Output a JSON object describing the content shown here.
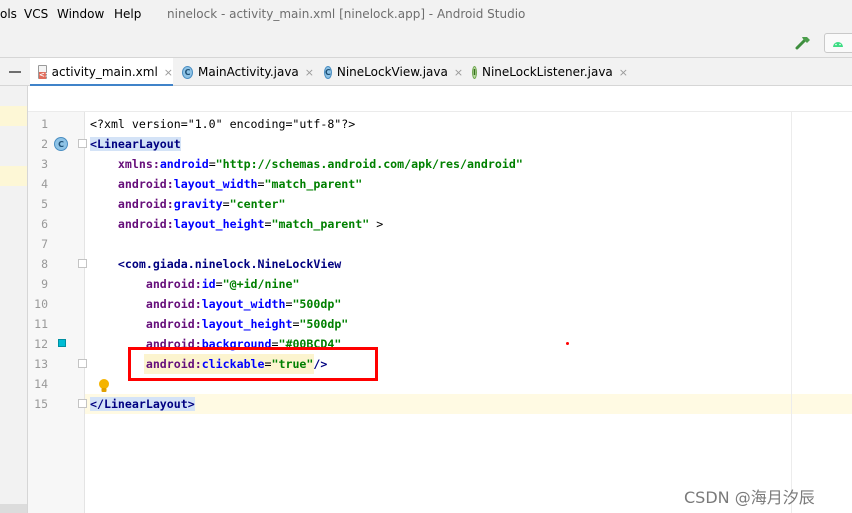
{
  "menu": {
    "items": [
      "ols",
      "VCS",
      "Window",
      "Help"
    ]
  },
  "window_title": "ninelock - activity_main.xml [ninelock.app] - Android Studio",
  "tabs": [
    {
      "label": "activity_main.xml",
      "icon": "xml-file-icon",
      "active": true
    },
    {
      "label": "MainActivity.java",
      "icon": "java-class-icon",
      "active": false
    },
    {
      "label": "NineLockView.java",
      "icon": "java-class-icon",
      "active": false
    },
    {
      "label": "NineLockListener.java",
      "icon": "java-interface-icon",
      "active": false
    }
  ],
  "tab_close_glyph": "×",
  "icon_letters": {
    "class": "C",
    "interface": "I"
  },
  "editor": {
    "line_numbers": [
      "1",
      "2",
      "3",
      "4",
      "5",
      "6",
      "7",
      "8",
      "9",
      "10",
      "11",
      "12",
      "13",
      "14",
      "15"
    ],
    "lines": [
      [
        {
          "t": "<?xml version=\"1.0\" encoding=\"utf-8\"?>",
          "c": "plain"
        }
      ],
      [
        {
          "t": "<LinearLayout",
          "c": "tag-hl"
        }
      ],
      [
        {
          "t": "    ",
          "c": "plain"
        },
        {
          "t": "xmlns:",
          "c": "ns"
        },
        {
          "t": "android",
          "c": "attr"
        },
        {
          "t": "=",
          "c": "plain"
        },
        {
          "t": "\"http://schemas.android.com/apk/res/android\"",
          "c": "val"
        }
      ],
      [
        {
          "t": "    ",
          "c": "plain"
        },
        {
          "t": "android:",
          "c": "ns"
        },
        {
          "t": "layout_width",
          "c": "attr"
        },
        {
          "t": "=",
          "c": "plain"
        },
        {
          "t": "\"match_parent\"",
          "c": "val"
        }
      ],
      [
        {
          "t": "    ",
          "c": "plain"
        },
        {
          "t": "android:",
          "c": "ns"
        },
        {
          "t": "gravity",
          "c": "attr"
        },
        {
          "t": "=",
          "c": "plain"
        },
        {
          "t": "\"center\"",
          "c": "val"
        }
      ],
      [
        {
          "t": "    ",
          "c": "plain"
        },
        {
          "t": "android:",
          "c": "ns"
        },
        {
          "t": "layout_height",
          "c": "attr"
        },
        {
          "t": "=",
          "c": "plain"
        },
        {
          "t": "\"match_parent\"",
          "c": "val"
        },
        {
          "t": " >",
          "c": "plain"
        }
      ],
      [
        {
          "t": "",
          "c": "plain"
        }
      ],
      [
        {
          "t": "    ",
          "c": "plain"
        },
        {
          "t": "<com.giada.ninelock.NineLockView",
          "c": "tag"
        }
      ],
      [
        {
          "t": "        ",
          "c": "plain"
        },
        {
          "t": "android:",
          "c": "ns"
        },
        {
          "t": "id",
          "c": "attr"
        },
        {
          "t": "=",
          "c": "plain"
        },
        {
          "t": "\"@+id/nine\"",
          "c": "val"
        }
      ],
      [
        {
          "t": "        ",
          "c": "plain"
        },
        {
          "t": "android:",
          "c": "ns"
        },
        {
          "t": "layout_width",
          "c": "attr"
        },
        {
          "t": "=",
          "c": "plain"
        },
        {
          "t": "\"500dp\"",
          "c": "val"
        }
      ],
      [
        {
          "t": "        ",
          "c": "plain"
        },
        {
          "t": "android:",
          "c": "ns"
        },
        {
          "t": "layout_height",
          "c": "attr"
        },
        {
          "t": "=",
          "c": "plain"
        },
        {
          "t": "\"500dp\"",
          "c": "val"
        }
      ],
      [
        {
          "t": "        ",
          "c": "plain"
        },
        {
          "t": "android:",
          "c": "ns"
        },
        {
          "t": "background",
          "c": "attr"
        },
        {
          "t": "=",
          "c": "plain"
        },
        {
          "t": "\"#00BCD4\"",
          "c": "val"
        }
      ],
      [
        {
          "t": "        ",
          "c": "plain"
        },
        {
          "t": "android:",
          "c": "ns"
        },
        {
          "t": "clickable",
          "c": "attr"
        },
        {
          "t": "=",
          "c": "plain"
        },
        {
          "t": "\"true\"",
          "c": "val"
        },
        {
          "t": "/>",
          "c": "tag"
        }
      ],
      [
        {
          "t": "",
          "c": "plain"
        }
      ],
      [
        {
          "t": "</LinearLayout>",
          "c": "tag-hl"
        }
      ]
    ]
  },
  "watermark": "CSDN @海月汐辰",
  "colors": {
    "accent_tab": "#4083c9",
    "highlight_box": "#ff0000",
    "background_swatch": "#00BCD4"
  }
}
